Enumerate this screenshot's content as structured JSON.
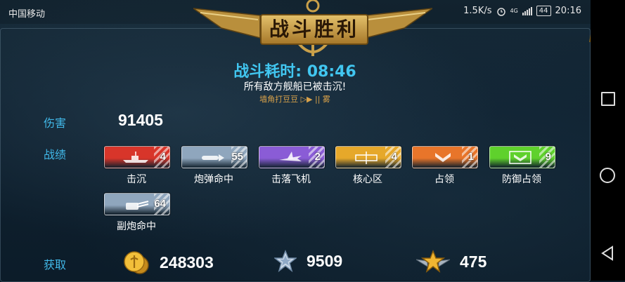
{
  "status_bar": {
    "carrier": "中国移动",
    "net_speed": "1.5K/s",
    "network_type": "4G",
    "battery": "44",
    "time": "20:16"
  },
  "banner": {
    "title": "战斗胜利"
  },
  "summary": {
    "duration": "战斗耗时: 08:46",
    "message": "所有敌方舰船已被击沉!",
    "sub": "墙角打豆豆 ▷▶   || 雾"
  },
  "damage": {
    "label": "伤害",
    "value": "91405"
  },
  "achievements": {
    "label": "战绩",
    "items": [
      {
        "label": "击沉",
        "count": "4",
        "color": "#d8352a",
        "icon": "ship-icon"
      },
      {
        "label": "炮弹命中",
        "count": "55",
        "color": "#8fa6bd",
        "icon": "shell-icon"
      },
      {
        "label": "击落飞机",
        "count": "2",
        "color": "#8a5cd6",
        "icon": "plane-icon"
      },
      {
        "label": "核心区",
        "count": "4",
        "color": "#e6a82a",
        "icon": "core-icon"
      },
      {
        "label": "占领",
        "count": "1",
        "color": "#e8752a",
        "icon": "capture-icon"
      },
      {
        "label": "防御占领",
        "count": "9",
        "color": "#5fd12c",
        "icon": "defend-icon"
      },
      {
        "label": "副炮命中",
        "count": "64",
        "color": "#8fa6bd",
        "icon": "secondary-gun-icon"
      }
    ]
  },
  "rewards": {
    "label": "获取",
    "items": [
      {
        "name": "coins",
        "value": "248303",
        "icon": "gold-coin-icon"
      },
      {
        "name": "experience",
        "value": "9509",
        "icon": "silver-star-icon"
      },
      {
        "name": "captain-exp",
        "value": "475",
        "icon": "gold-winged-star-icon"
      }
    ]
  },
  "close_label": "✕"
}
